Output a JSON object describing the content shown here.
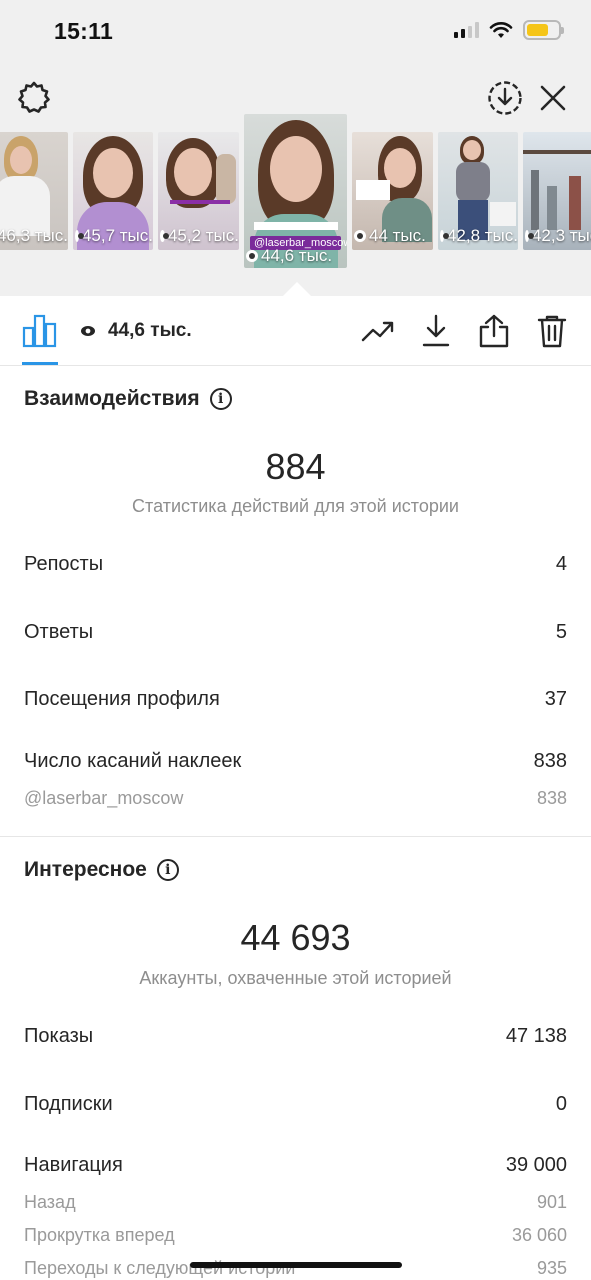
{
  "status_bar": {
    "time": "15:11"
  },
  "thumbnails": [
    {
      "views": "46,3 тыс."
    },
    {
      "views": "45,7 тыс."
    },
    {
      "views": "45,2 тыс."
    },
    {
      "views": "44,6 тыс.",
      "tag": "@laserbar_moscow",
      "selected": true
    },
    {
      "views": "44 тыс."
    },
    {
      "views": "42,8 тыс."
    },
    {
      "views": "42,3 тыс."
    }
  ],
  "toolbar": {
    "views": "44,6 тыс."
  },
  "interactions": {
    "title": "Взаимодействия",
    "total": "884",
    "total_caption": "Статистика действий для этой истории",
    "rows": [
      {
        "label": "Репосты",
        "value": "4"
      },
      {
        "label": "Ответы",
        "value": "5"
      },
      {
        "label": "Посещения профиля",
        "value": "37"
      },
      {
        "label": "Число касаний наклеек",
        "value": "838"
      }
    ],
    "sub_rows": [
      {
        "label": "@laserbar_moscow",
        "value": "838"
      }
    ]
  },
  "discovery": {
    "title": "Интересное",
    "total": "44 693",
    "total_caption": "Аккаунты, охваченные этой историей",
    "rows": [
      {
        "label": "Показы",
        "value": "47 138"
      },
      {
        "label": "Подписки",
        "value": "0"
      },
      {
        "label": "Навигация",
        "value": "39 000"
      }
    ],
    "sub_rows": [
      {
        "label": "Назад",
        "value": "901"
      },
      {
        "label": "Прокрутка вперед",
        "value": "36 060"
      },
      {
        "label": "Переходы к следующей истории",
        "value": "935"
      }
    ]
  },
  "colors": {
    "accent": "#2a95e6",
    "tag": "#7a2b9a",
    "battery": "#f5c518"
  }
}
